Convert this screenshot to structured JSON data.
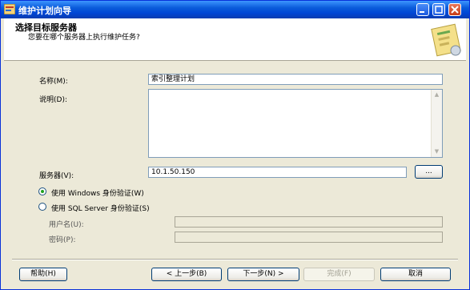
{
  "window": {
    "title": "维护计划向导"
  },
  "header": {
    "title": "选择目标服务器",
    "subtitle": "您要在哪个服务器上执行维护任务?"
  },
  "form": {
    "name_label": "名称(M):",
    "name_value": "索引整理计划",
    "description_label": "说明(D):",
    "description_value": "",
    "server_label": "服务器(V):",
    "server_value": "10.1.50.150",
    "browse_label": "...",
    "auth_windows_label": "使用 Windows 身份验证(W)",
    "auth_sql_label": "使用 SQL Server 身份验证(S)",
    "auth_selected": "windows",
    "username_label": "用户名(U):",
    "username_value": "",
    "password_label": "密码(P):",
    "password_value": ""
  },
  "footer": {
    "help_label": "帮助(H)",
    "back_label": "< 上一步(B)",
    "next_label": "下一步(N) >",
    "finish_label": "完成(F)",
    "cancel_label": "取消"
  },
  "colors": {
    "titlebar": "#0a5bda",
    "dialog_bg": "#ece9d8",
    "border": "#7f9db9"
  }
}
